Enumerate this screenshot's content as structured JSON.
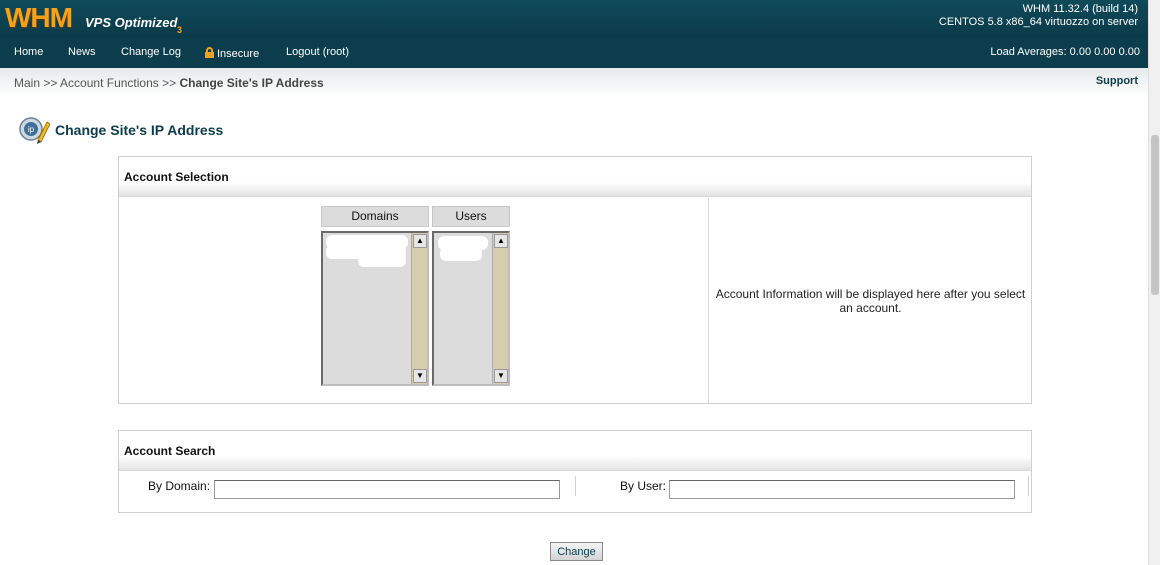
{
  "header": {
    "logo_main": "WHM",
    "logo_sub": "VPS Optimized",
    "logo_version": "3",
    "version_line1": "WHM 11.32.4 (build 14)",
    "version_line2": "CENTOS 5.8 x86_64 virtuozzo on server"
  },
  "nav": {
    "home": "Home",
    "news": "News",
    "changelog": "Change Log",
    "insecure": "Insecure",
    "logout": "Logout (root)",
    "load_averages": "Load Averages: 0.00 0.00 0.00"
  },
  "breadcrumb": {
    "main": "Main",
    "separator": ">>",
    "section": "Account Functions",
    "current": "Change Site's IP Address",
    "support": "Support"
  },
  "page": {
    "title": "Change Site's IP Address"
  },
  "account_selection": {
    "heading": "Account Selection",
    "domains_header": "Domains",
    "users_header": "Users",
    "info_text": "Account Information will be displayed here after you select an account."
  },
  "account_search": {
    "heading": "Account Search",
    "by_domain_label": "By Domain:",
    "by_user_label": "By User:",
    "by_domain_value": "",
    "by_user_value": ""
  },
  "actions": {
    "change_label": "Change"
  },
  "colors": {
    "header_bg": "#0f4a5b",
    "nav_bg": "#0c3d4c",
    "logo_orange": "#f4a21a",
    "title_color": "#0c3d4c"
  }
}
